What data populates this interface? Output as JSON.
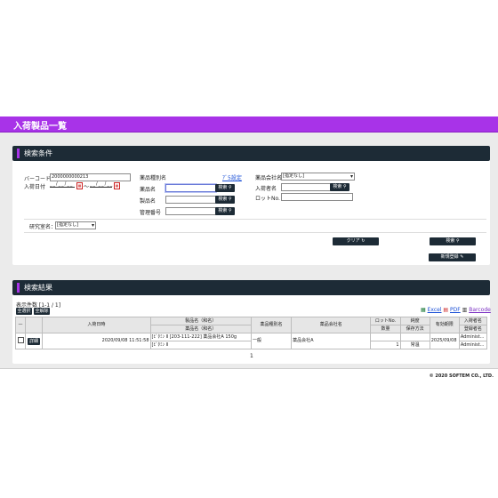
{
  "page": {
    "title": "入荷製品一覧",
    "copyright": "© 2020 SOFTEM CO., LTD."
  },
  "search": {
    "header": "検索条件",
    "barcode_label": "バーコード",
    "barcode_value": "2000000000213",
    "arrival_date_label": "入荷日付",
    "date_placeholder": "__/__/__",
    "date_separator": "～",
    "drug_type_label": "薬品種別名",
    "drug_type_link": "ｱﾞ5設定",
    "drug_name_label": "薬品名",
    "product_name_label": "製品名",
    "mgmt_no_label": "管理番号",
    "company_label": "薬品会社名",
    "company_value": "[指定なし]",
    "receiver_label": "入荷者名",
    "lot_label": "ロットNo.",
    "lab_label": "研究室名：",
    "lab_value": "[指定なし]",
    "search_btn": "検索",
    "clear_btn": "クリア",
    "new_btn": "新規登録"
  },
  "results": {
    "header": "検索結果",
    "count_text": "表示件数 [1-1 / 1]",
    "select_all": "全選択",
    "deselect_all": "全解除",
    "export_excel": "Excel",
    "export_pdf": "PDF",
    "export_barcode": "Barcode",
    "columns": {
      "arrival_date": "入荷日時",
      "drug_name_top": "製品名（和名）",
      "drug_name_bottom": "薬品名（和名）",
      "drug_type": "薬品種別名",
      "company": "薬品会社名",
      "lot": "ロットNo.",
      "qty": "数量",
      "purity": "純度",
      "storage": "保存方法",
      "expiry": "有効期限",
      "receiver": "入荷者名",
      "registrant": "登録者名"
    },
    "rows": [
      {
        "detail_btn": "詳細",
        "arrival_date": "2020/09/08 11:51:58",
        "product": "[ﾋﾞﾀﾐﾝ Ⅱ [203-111-222] 薬品会社A 150g",
        "drug": "[ﾋﾞﾀﾐﾝ Ⅱ",
        "drug_type": "一般",
        "company": "薬品会社A",
        "lot": "",
        "qty": "1",
        "purity": "",
        "storage": "常温",
        "expiry": "2025/09/08",
        "receiver": "Administ...",
        "registrant": "Administ..."
      }
    ],
    "page_number": "1"
  }
}
